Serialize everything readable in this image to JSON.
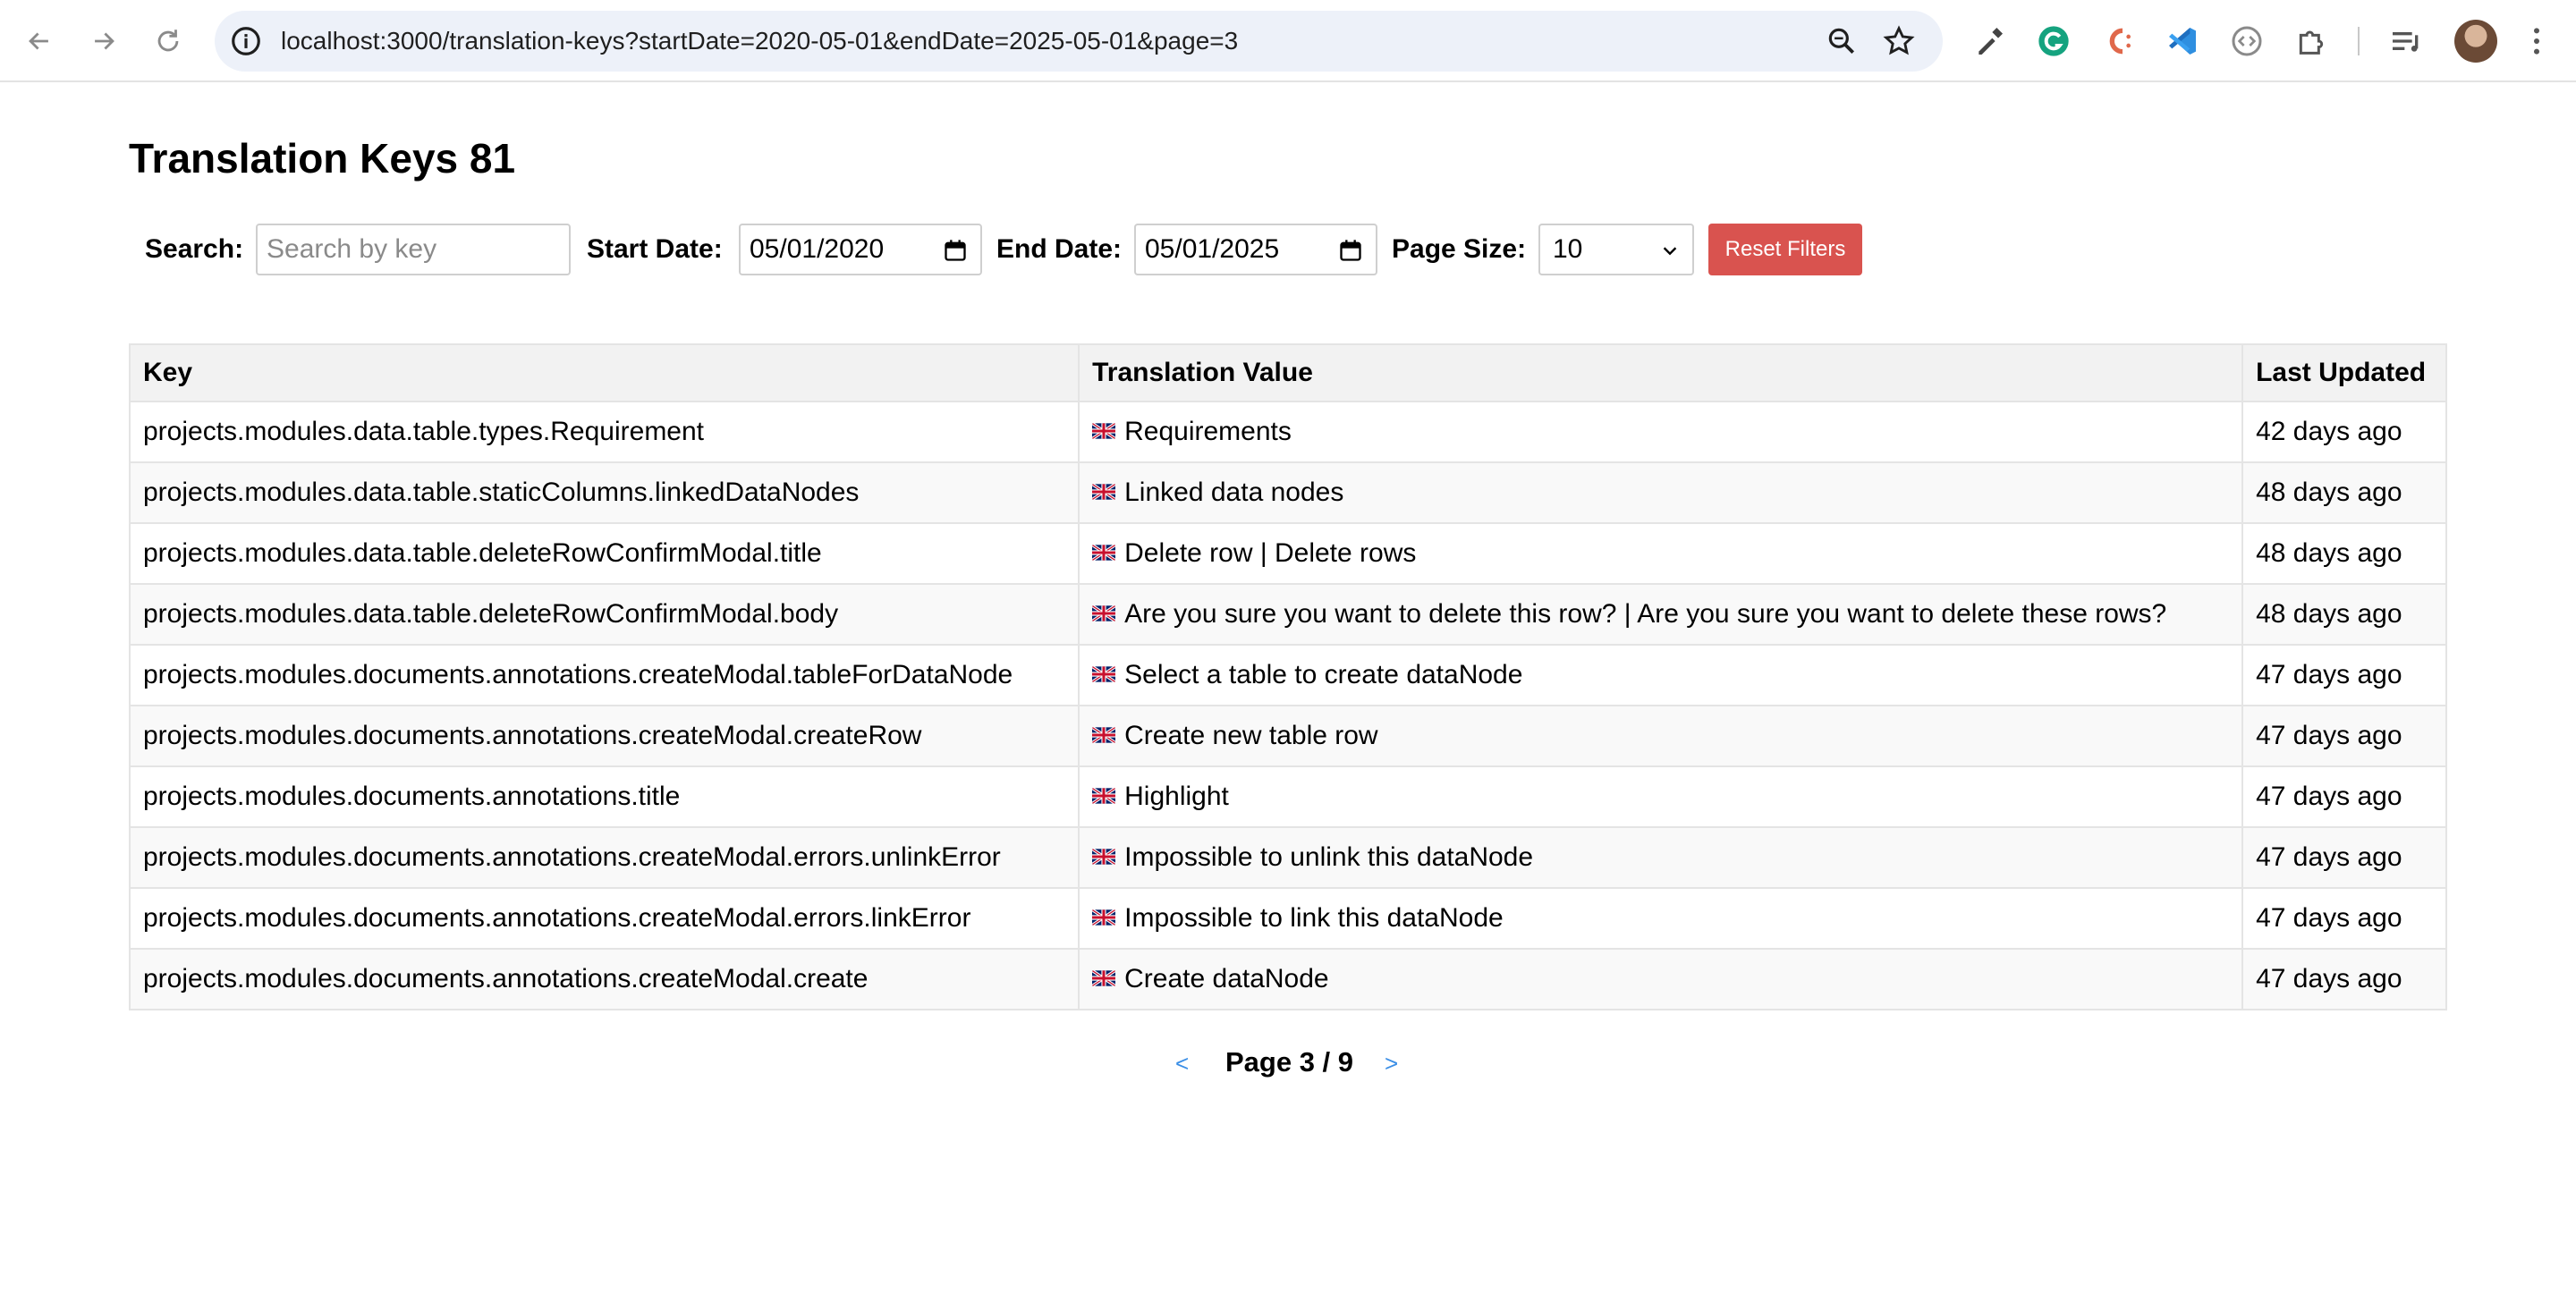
{
  "browser": {
    "url": "localhost:3000/translation-keys?startDate=2020-05-01&endDate=2025-05-01&page=3"
  },
  "page": {
    "title": "Translation Keys 81"
  },
  "filters": {
    "search_label": "Search:",
    "search_placeholder": "Search by key",
    "search_value": "",
    "start_date_label": "Start Date:",
    "start_date_value": "05/01/2020",
    "end_date_label": "End Date:",
    "end_date_value": "05/01/2025",
    "page_size_label": "Page Size:",
    "page_size_value": "10",
    "reset_label": "Reset Filters"
  },
  "table": {
    "headers": [
      "Key",
      "Translation Value",
      "Last Updated"
    ],
    "rows": [
      {
        "key": "projects.modules.data.table.types.Requirement",
        "flag": "uk-flag-icon",
        "value": "Requirements",
        "updated": "42 days ago"
      },
      {
        "key": "projects.modules.data.table.staticColumns.linkedDataNodes",
        "flag": "uk-flag-icon",
        "value": "Linked data nodes",
        "updated": "48 days ago"
      },
      {
        "key": "projects.modules.data.table.deleteRowConfirmModal.title",
        "flag": "uk-flag-icon",
        "value": "Delete row | Delete rows",
        "updated": "48 days ago"
      },
      {
        "key": "projects.modules.data.table.deleteRowConfirmModal.body",
        "flag": "uk-flag-icon",
        "value": "Are you sure you want to delete this row? | Are you sure you want to delete these rows?",
        "updated": "48 days ago"
      },
      {
        "key": "projects.modules.documents.annotations.createModal.tableForDataNode",
        "flag": "uk-flag-icon",
        "value": "Select a table to create dataNode",
        "updated": "47 days ago"
      },
      {
        "key": "projects.modules.documents.annotations.createModal.createRow",
        "flag": "uk-flag-icon",
        "value": "Create new table row",
        "updated": "47 days ago"
      },
      {
        "key": "projects.modules.documents.annotations.title",
        "flag": "uk-flag-icon",
        "value": "Highlight",
        "updated": "47 days ago"
      },
      {
        "key": "projects.modules.documents.annotations.createModal.errors.unlinkError",
        "flag": "uk-flag-icon",
        "value": "Impossible to unlink this dataNode",
        "updated": "47 days ago"
      },
      {
        "key": "projects.modules.documents.annotations.createModal.errors.linkError",
        "flag": "uk-flag-icon",
        "value": "Impossible to link this dataNode",
        "updated": "47 days ago"
      },
      {
        "key": "projects.modules.documents.annotations.createModal.create",
        "flag": "uk-flag-icon",
        "value": "Create dataNode",
        "updated": "47 days ago"
      }
    ]
  },
  "pagination": {
    "prev_label": "<",
    "text": "Page 3 / 9",
    "next_label": ">"
  }
}
